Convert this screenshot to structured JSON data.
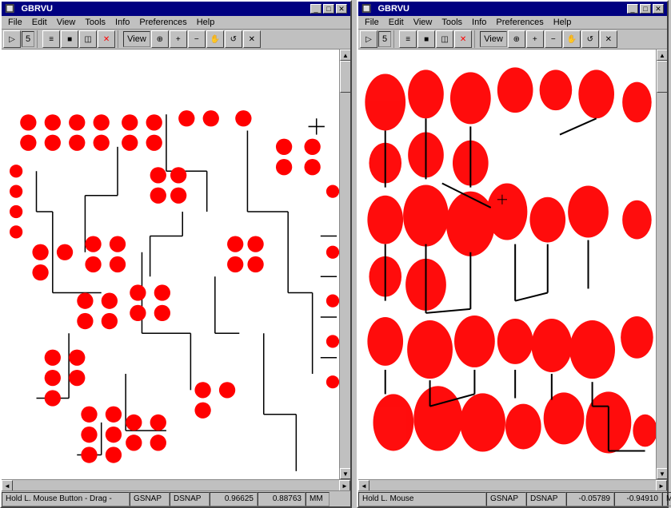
{
  "left_window": {
    "title": "GBRVU",
    "menu": [
      "File",
      "Edit",
      "View",
      "Tools",
      "Info",
      "Preferences",
      "Help"
    ],
    "toolbar": {
      "buttons": [
        "▷",
        "5",
        "≡",
        "□",
        "◫",
        "✕",
        "View",
        "🔍",
        "🔍+",
        "🔍-",
        "✋",
        "↩",
        "✕"
      ]
    },
    "status": {
      "hint": "Hold L. Mouse Button - Drag -",
      "snap1": "GSNAP",
      "snap2": "DSNAP",
      "x": "0.96625",
      "y": "0.88763",
      "unit": "MM"
    }
  },
  "right_window": {
    "title": "GBRVU",
    "menu": [
      "File",
      "Edit",
      "View",
      "Tools",
      "Info",
      "Preferences",
      "Help"
    ],
    "toolbar": {
      "buttons": [
        "▷",
        "5",
        "≡",
        "□",
        "◫",
        "✕",
        "View",
        "🔍",
        "🔍+",
        "🔍-",
        "✋",
        "↩",
        "✕"
      ]
    },
    "status": {
      "hint": "Hold L. Mouse",
      "snap1": "GSNAP",
      "snap2": "DSNAP",
      "x": "-0.05789",
      "y": "-0.94910",
      "unit": "MM"
    }
  }
}
